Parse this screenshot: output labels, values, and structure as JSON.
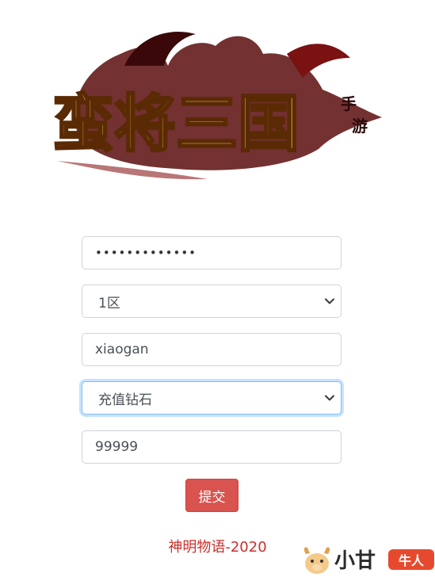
{
  "logo": {
    "title_text": "蛮将三国",
    "tag_text": "手游"
  },
  "form": {
    "password_mask": "•••••••••••••",
    "server_value": "1区",
    "username_value": "xiaogan",
    "item_value": "充值钻石",
    "amount_value": "99999",
    "submit_label": "提交"
  },
  "footer": {
    "text": "神明物语-2020"
  },
  "watermark": {
    "text": "小甘",
    "badge": "牛人"
  },
  "colors": {
    "submit_bg": "#d9534f",
    "footer_text": "#c9302c",
    "focus_border": "#80bdff"
  }
}
